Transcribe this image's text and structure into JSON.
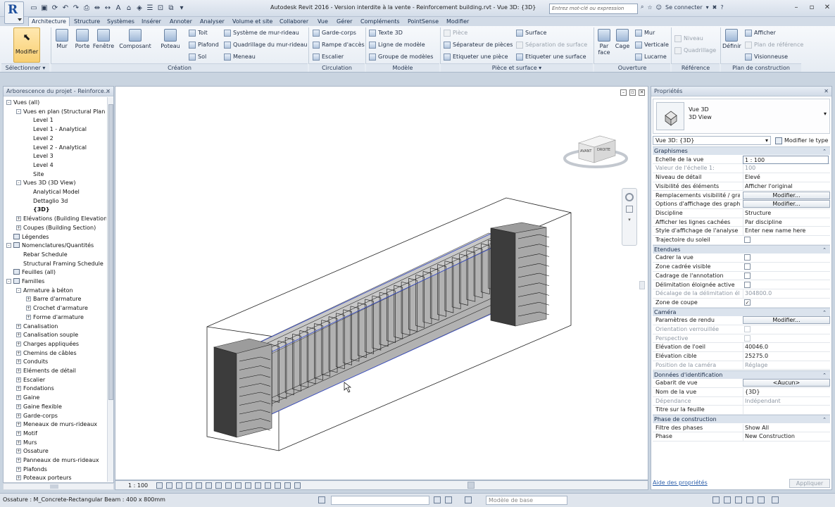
{
  "app": {
    "title": "Autodesk Revit 2016 - Version interdite à la vente -    Reinforcement building.rvt - Vue 3D: {3D}",
    "search_placeholder": "Entrez mot-clé ou expression",
    "sign_in": "Se connecter",
    "logo_letter": "R"
  },
  "tabs": [
    "Architecture",
    "Structure",
    "Systèmes",
    "Insérer",
    "Annoter",
    "Analyser",
    "Volume et site",
    "Collaborer",
    "Vue",
    "Gérer",
    "Compléments",
    "PointSense",
    "Modifier"
  ],
  "ribbon": {
    "select": {
      "modify": "Modifier",
      "title": "Sélectionner ▾"
    },
    "creation": {
      "title": "Création",
      "big": [
        "Mur",
        "Porte",
        "Fenêtre",
        "Composant",
        "Poteau"
      ],
      "small": [
        "Toit",
        "Plafond",
        "Sol",
        "Système de mur-rideau",
        "Quadrillage du mur-rideau",
        "Meneau"
      ]
    },
    "circulation": {
      "title": "Circulation",
      "items": [
        "Garde-corps",
        "Rampe d'accès",
        "Escalier"
      ]
    },
    "modele": {
      "title": "Modèle",
      "items": [
        "Texte 3D",
        "Ligne de modèle",
        "Groupe de modèles"
      ]
    },
    "piece": {
      "title": "Pièce et surface ▾",
      "items": [
        "Pièce",
        "Séparateur de pièces",
        "Etiqueter une pièce",
        "Surface",
        "Séparation de surface",
        "Etiqueter une surface"
      ]
    },
    "ouverture": {
      "title": "Ouverture",
      "big": [
        "Par face",
        "Cage"
      ],
      "small": [
        "Mur",
        "Verticale",
        "Lucarne"
      ]
    },
    "reference": {
      "title": "Référence",
      "items": [
        "Niveau",
        "Quadrillage"
      ]
    },
    "plan": {
      "title": "Plan de construction",
      "big": "Définir",
      "small": [
        "Afficher",
        "Plan de référence",
        "Visionneuse"
      ]
    }
  },
  "project_browser": {
    "title": "Arborescence du projet - Reinforce...",
    "nodes": [
      {
        "label": "Vues (all)",
        "level": 0,
        "exp": "-"
      },
      {
        "label": "Vues en plan (Structural Plan",
        "level": 1,
        "exp": "-"
      },
      {
        "label": "Level 1",
        "level": 2,
        "exp": ""
      },
      {
        "label": "Level 1 - Analytical",
        "level": 2,
        "exp": ""
      },
      {
        "label": "Level 2",
        "level": 2,
        "exp": ""
      },
      {
        "label": "Level 2 - Analytical",
        "level": 2,
        "exp": ""
      },
      {
        "label": "Level 3",
        "level": 2,
        "exp": ""
      },
      {
        "label": "Level 4",
        "level": 2,
        "exp": ""
      },
      {
        "label": "Site",
        "level": 2,
        "exp": ""
      },
      {
        "label": "Vues 3D (3D View)",
        "level": 1,
        "exp": "-"
      },
      {
        "label": "Analytical Model",
        "level": 2,
        "exp": ""
      },
      {
        "label": "Dettaglio 3d",
        "level": 2,
        "exp": ""
      },
      {
        "label": "{3D}",
        "level": 2,
        "exp": "",
        "bold": true
      },
      {
        "label": "Elévations (Building Elevation",
        "level": 1,
        "exp": "+"
      },
      {
        "label": "Coupes (Building Section)",
        "level": 1,
        "exp": "+"
      },
      {
        "label": "Légendes",
        "level": 0,
        "exp": "",
        "icon": true
      },
      {
        "label": "Nomenclatures/Quantités",
        "level": 0,
        "exp": "-",
        "icon": true
      },
      {
        "label": "Rebar Schedule",
        "level": 1,
        "exp": ""
      },
      {
        "label": "Structural Framing Schedule",
        "level": 1,
        "exp": ""
      },
      {
        "label": "Feuilles (all)",
        "level": 0,
        "exp": "",
        "icon": true
      },
      {
        "label": "Familles",
        "level": 0,
        "exp": "-",
        "icon": true
      },
      {
        "label": "Armature à béton",
        "level": 1,
        "exp": "-"
      },
      {
        "label": "Barre d'armature",
        "level": 2,
        "exp": "+"
      },
      {
        "label": "Crochet d'armature",
        "level": 2,
        "exp": "+"
      },
      {
        "label": "Forme d'armature",
        "level": 2,
        "exp": "+"
      },
      {
        "label": "Canalisation",
        "level": 1,
        "exp": "+"
      },
      {
        "label": "Canalisation souple",
        "level": 1,
        "exp": "+"
      },
      {
        "label": "Charges appliquées",
        "level": 1,
        "exp": "+"
      },
      {
        "label": "Chemins de câbles",
        "level": 1,
        "exp": "+"
      },
      {
        "label": "Conduits",
        "level": 1,
        "exp": "+"
      },
      {
        "label": "Eléments de détail",
        "level": 1,
        "exp": "+"
      },
      {
        "label": "Escalier",
        "level": 1,
        "exp": "+"
      },
      {
        "label": "Fondations",
        "level": 1,
        "exp": "+"
      },
      {
        "label": "Gaine",
        "level": 1,
        "exp": "+"
      },
      {
        "label": "Gaine flexible",
        "level": 1,
        "exp": "+"
      },
      {
        "label": "Garde-corps",
        "level": 1,
        "exp": "+"
      },
      {
        "label": "Meneaux de murs-rideaux",
        "level": 1,
        "exp": "+"
      },
      {
        "label": "Motif",
        "level": 1,
        "exp": "+"
      },
      {
        "label": "Murs",
        "level": 1,
        "exp": "+"
      },
      {
        "label": "Ossature",
        "level": 1,
        "exp": "+"
      },
      {
        "label": "Panneaux de murs-rideaux",
        "level": 1,
        "exp": "+"
      },
      {
        "label": "Plafonds",
        "level": 1,
        "exp": "+"
      },
      {
        "label": "Poteaux porteurs",
        "level": 1,
        "exp": "+"
      }
    ]
  },
  "viewport": {
    "scale": "1 : 100",
    "viewcube_front": "AVANT",
    "viewcube_right": "DROITE"
  },
  "properties": {
    "title": "Propriétés",
    "type_name": "Vue 3D",
    "type_sub": "3D View",
    "selector": "Vue 3D: {3D}",
    "edit_type": "Modifier le type",
    "sections": [
      {
        "name": "Graphismes",
        "rows": [
          {
            "k": "Echelle de la vue",
            "v": "1 : 100",
            "kind": "input"
          },
          {
            "k": "Valeur de l'échelle   1:",
            "v": "100",
            "kind": "ro"
          },
          {
            "k": "Niveau de détail",
            "v": "Elevé",
            "kind": "text"
          },
          {
            "k": "Visibilité des éléments",
            "v": "Afficher l'original",
            "kind": "text"
          },
          {
            "k": "Remplacements visibilité / gra...",
            "v": "Modifier...",
            "kind": "button"
          },
          {
            "k": "Options d'affichage des graphi...",
            "v": "Modifier...",
            "kind": "button"
          },
          {
            "k": "Discipline",
            "v": "Structure",
            "kind": "text"
          },
          {
            "k": "Afficher les lignes cachées",
            "v": "Par discipline",
            "kind": "text"
          },
          {
            "k": "Style d'affichage de l'analyse p...",
            "v": "Enter new name here",
            "kind": "text"
          },
          {
            "k": "Trajectoire du soleil",
            "v": "",
            "kind": "check"
          }
        ]
      },
      {
        "name": "Etendues",
        "rows": [
          {
            "k": "Cadrer la vue",
            "v": "",
            "kind": "check"
          },
          {
            "k": "Zone cadrée visible",
            "v": "",
            "kind": "check"
          },
          {
            "k": "Cadrage de l'annotation",
            "v": "",
            "kind": "check"
          },
          {
            "k": "Délimitation éloignée active",
            "v": "",
            "kind": "check"
          },
          {
            "k": "Décalage de la délimitation élo...",
            "v": "304800.0",
            "kind": "ro"
          },
          {
            "k": "Zone de coupe",
            "v": "✓",
            "kind": "checked"
          }
        ]
      },
      {
        "name": "Caméra",
        "rows": [
          {
            "k": "Paramètres de rendu",
            "v": "Modifier...",
            "kind": "button"
          },
          {
            "k": "Orientation verrouillée",
            "v": "",
            "kind": "rocheck"
          },
          {
            "k": "Perspective",
            "v": "",
            "kind": "rocheck"
          },
          {
            "k": "Elévation de l'oeil",
            "v": "40046.0",
            "kind": "text"
          },
          {
            "k": "Elévation cible",
            "v": "25275.0",
            "kind": "text"
          },
          {
            "k": "Position de la caméra",
            "v": "Réglage",
            "kind": "ro"
          }
        ]
      },
      {
        "name": "Données d'identification",
        "rows": [
          {
            "k": "Gabarit de vue",
            "v": "<Aucun>",
            "kind": "button"
          },
          {
            "k": "Nom de la vue",
            "v": "{3D}",
            "kind": "text"
          },
          {
            "k": "Dépendance",
            "v": "Indépendant",
            "kind": "ro"
          },
          {
            "k": "Titre sur la feuille",
            "v": "",
            "kind": "text"
          }
        ]
      },
      {
        "name": "Phase de construction",
        "rows": [
          {
            "k": "Filtre des phases",
            "v": "Show All",
            "kind": "text"
          },
          {
            "k": "Phase",
            "v": "New Construction",
            "kind": "text"
          }
        ]
      }
    ],
    "help_link": "Aide des propriétés",
    "apply": "Appliquer"
  },
  "status": {
    "text": "Ossature : M_Concrete-Rectangular Beam : 400 x 800mm",
    "model": "Modèle de base"
  },
  "colors": {
    "accent": "#1e4f9c",
    "ribbon": "#e6ecf3",
    "concrete": "#7a7a7a",
    "rebar": "#333333",
    "selection": "#3b4fc4"
  }
}
